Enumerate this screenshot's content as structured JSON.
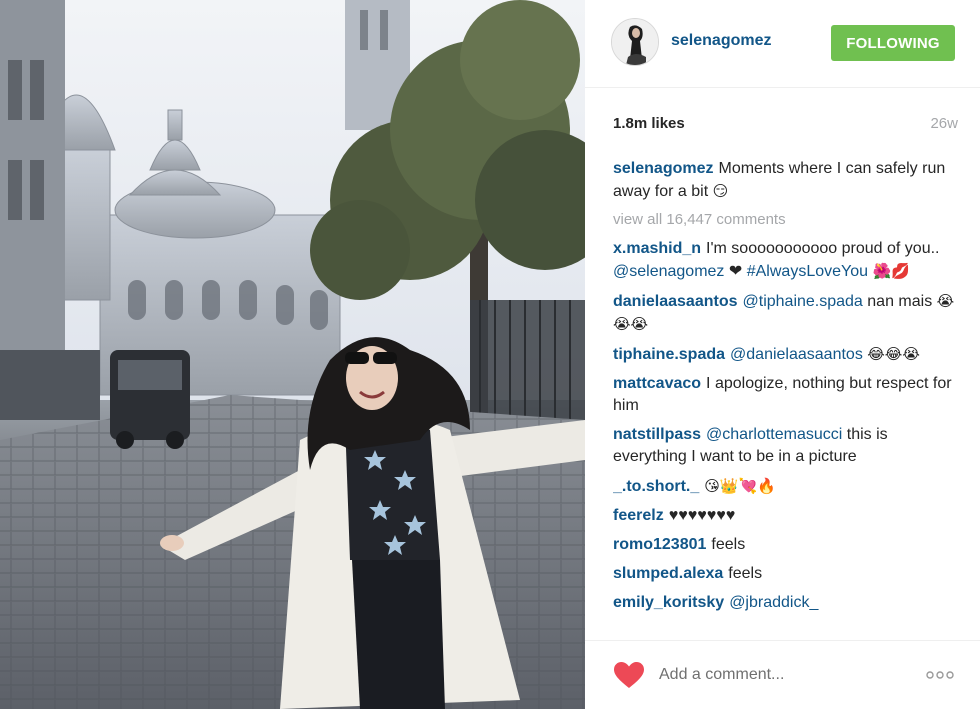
{
  "post": {
    "username": "selenagomez",
    "follow_label": "FOLLOWING",
    "likes": "1.8m likes",
    "age": "26w",
    "caption": {
      "user": "selenagomez",
      "text": "Moments where I can safely run away for a bit",
      "emoji": "😏"
    },
    "view_all": "view all 16,447 comments",
    "comments": [
      {
        "user": "x.mashid_n",
        "text": "I'm sooooooooooo proud of you..",
        "mention": "@selenagomez",
        "extra": "❤",
        "tag": "#AlwaysLoveYou",
        "emoji": "🌺💋"
      },
      {
        "user": "danielaasaantos",
        "mention": "@tiphaine.spada",
        "text": "nan mais",
        "emoji": "😭😭😭"
      },
      {
        "user": "tiphaine.spada",
        "mention": "@danielaasaantos",
        "emoji": "😂😂😭"
      },
      {
        "user": "mattcavaco",
        "text": "I apologize, nothing but respect for him"
      },
      {
        "user": "natstillpass",
        "mention": "@charlottemasucci",
        "text": "this is everything I want to be in a picture"
      },
      {
        "user": "_.to.short._",
        "emoji": "😘👑💘🔥"
      },
      {
        "user": "feerelz",
        "text": "♥♥♥♥♥♥♥"
      },
      {
        "user": "romo123801",
        "text": "feels"
      },
      {
        "user": "slumped.alexa",
        "text": "feels"
      },
      {
        "user": "emily_koritsky",
        "mention": "@jbraddick_"
      }
    ],
    "add_comment_placeholder": "Add a comment...",
    "colors": {
      "username": "#125688",
      "follow_button": "#70c050",
      "like_heart": "#ed4956",
      "muted_text": "#a5a7aa"
    },
    "icons": {
      "like": "heart-icon",
      "more": "more-options-icon"
    }
  }
}
